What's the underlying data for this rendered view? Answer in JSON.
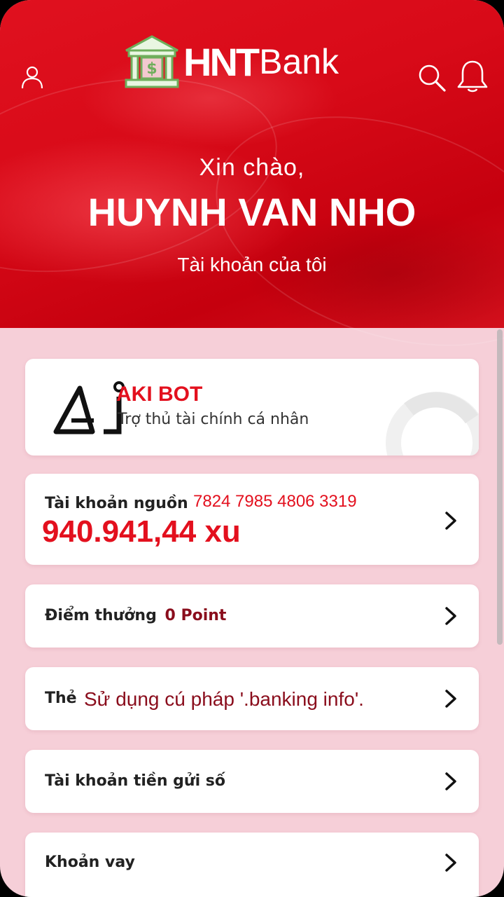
{
  "header": {
    "brand_hnt": "HNT",
    "brand_bank": "Bank",
    "icons": [
      "user-icon",
      "search-icon",
      "bell-icon",
      "bank-building-icon"
    ]
  },
  "greeting": {
    "hello": "Xin chào,",
    "name": "HUYNH VAN NHO",
    "subtitle": "Tài khoản của tôi"
  },
  "akibot": {
    "logo_text": "Ai",
    "title": "AKI BOT",
    "subtitle": "Trợ thủ tài chính cá nhân"
  },
  "source_account": {
    "label": "Tài khoản nguồn",
    "number": "7824 7985 4806 3319",
    "balance": "940.941,44 xu"
  },
  "points": {
    "label": "Điểm thưởng",
    "value": "0 Point"
  },
  "card": {
    "label": "Thẻ",
    "value": "Sử dụng cú pháp '.banking info'."
  },
  "savings": {
    "label": "Tài khoản tiền gửi số"
  },
  "loan": {
    "label": "Khoản vay"
  },
  "colors": {
    "brand_red": "#d80a18",
    "accent_red": "#e3101e",
    "dark_red": "#8a0d1c",
    "background_pink": "#f6cfd8"
  }
}
